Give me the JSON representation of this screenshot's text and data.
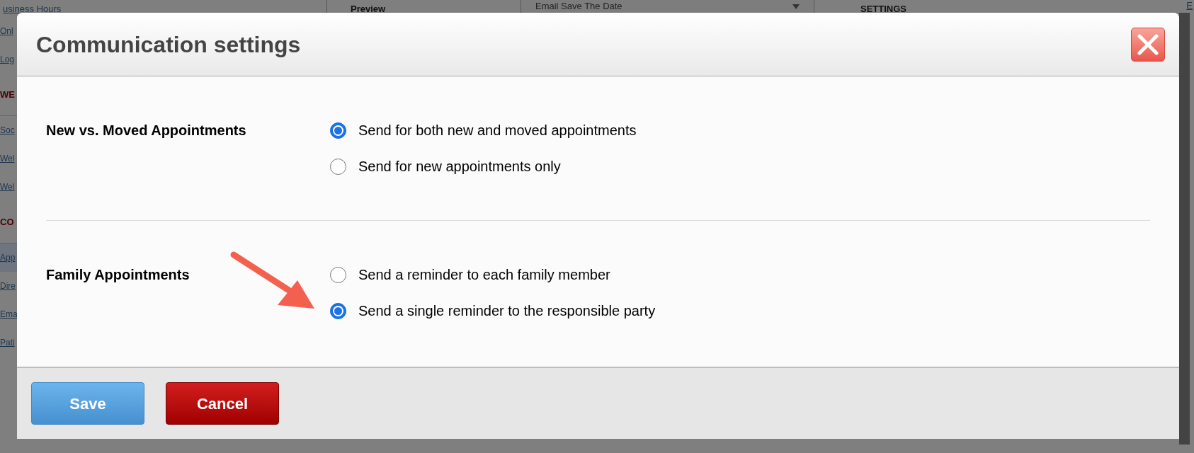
{
  "background": {
    "top_bar": [
      {
        "kind": "link",
        "text": "usiness Hours"
      },
      {
        "kind": "heading",
        "text": "Preview"
      },
      {
        "kind": "dropdown",
        "text": "Email Save The Date"
      },
      {
        "kind": "heading",
        "text": "SETTINGS"
      },
      {
        "kind": "link",
        "text": "E"
      }
    ],
    "sidebar": [
      {
        "kind": "link",
        "text": "Onl",
        "selected": false
      },
      {
        "kind": "link",
        "text": "Log",
        "selected": false
      },
      {
        "kind": "section",
        "text": "WE",
        "selected": false
      },
      {
        "kind": "link",
        "text": "Soc",
        "selected": false
      },
      {
        "kind": "link",
        "text": "Wel",
        "selected": false
      },
      {
        "kind": "link",
        "text": "Wel",
        "selected": false
      },
      {
        "kind": "section",
        "text": "CO",
        "selected": false
      },
      {
        "kind": "link",
        "text": "App",
        "selected": true
      },
      {
        "kind": "link",
        "text": "Dire",
        "selected": false
      },
      {
        "kind": "link",
        "text": "Ema",
        "selected": false
      },
      {
        "kind": "link",
        "text": "Pati",
        "selected": false
      }
    ]
  },
  "dialog": {
    "title": "Communication settings",
    "settings": [
      {
        "label": "New vs. Moved Appointments",
        "options": [
          {
            "label": "Send for both new and moved appointments",
            "selected": true
          },
          {
            "label": "Send for new appointments only",
            "selected": false
          }
        ]
      },
      {
        "label": "Family Appointments",
        "options": [
          {
            "label": "Send a reminder to each family member",
            "selected": false
          },
          {
            "label": "Send a single reminder to the responsible party",
            "selected": true
          }
        ]
      }
    ],
    "buttons": [
      {
        "kind": "primary",
        "label": "Save"
      },
      {
        "kind": "danger",
        "label": "Cancel"
      }
    ]
  },
  "annotation": {
    "kind": "arrow"
  }
}
